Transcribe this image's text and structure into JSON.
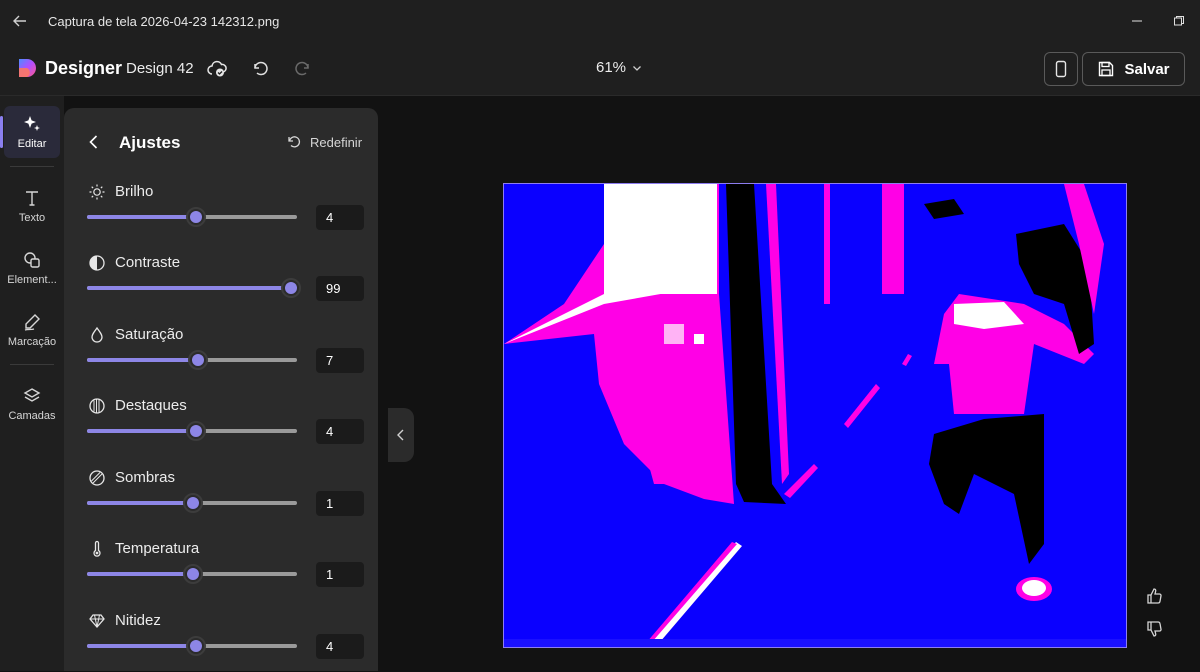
{
  "titlebar": {
    "file_name": "Captura de tela 2026-04-23 142312.png",
    "back_icon": "arrow-left-icon",
    "minimize_icon": "minimize-icon",
    "restore_icon": "restore-icon"
  },
  "appbar": {
    "brand": "Designer",
    "design_name": "Design 42",
    "zoom": "61%",
    "save_label": "Salvar"
  },
  "rail": {
    "items": [
      {
        "label": "Editar",
        "icon": "sparkle-icon",
        "active": true
      },
      {
        "label": "Texto",
        "icon": "text-icon",
        "active": false
      },
      {
        "label": "Element...",
        "icon": "shapes-icon",
        "active": false
      },
      {
        "label": "Marcação",
        "icon": "pen-icon",
        "active": false
      },
      {
        "label": "Camadas",
        "icon": "layers-icon",
        "active": false
      }
    ]
  },
  "panel": {
    "title": "Ajustes",
    "reset_label": "Redefinir",
    "adjustments": [
      {
        "label": "Brilho",
        "icon": "sun-icon",
        "value": "4",
        "level": 0.52
      },
      {
        "label": "Contraste",
        "icon": "contrast-icon",
        "value": "99",
        "level": 0.97
      },
      {
        "label": "Saturação",
        "icon": "droplet-icon",
        "value": "7",
        "level": 0.53
      },
      {
        "label": "Destaques",
        "icon": "highlights-icon",
        "value": "4",
        "level": 0.52
      },
      {
        "label": "Sombras",
        "icon": "shadows-icon",
        "value": "1",
        "level": 0.505
      },
      {
        "label": "Temperatura",
        "icon": "thermometer-icon",
        "value": "1",
        "level": 0.505
      },
      {
        "label": "Nitidez",
        "icon": "diamond-icon",
        "value": "4",
        "level": 0.52
      }
    ]
  },
  "colors": {
    "accent": "#8d86e6",
    "image_blue": "#0a00ff",
    "image_magenta": "#ff00e6"
  }
}
